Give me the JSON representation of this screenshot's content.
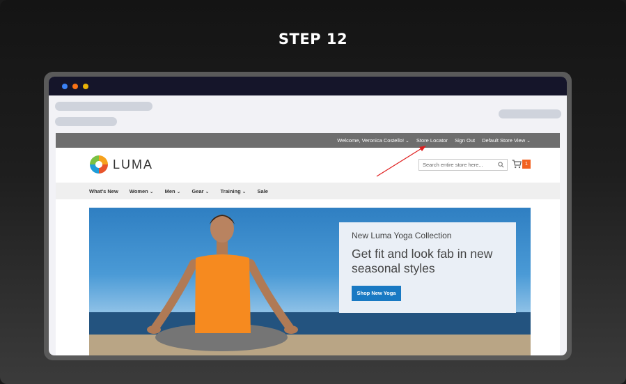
{
  "step": {
    "title": "STEP 12"
  },
  "topbar": {
    "welcome": "Welcome, Veronica Costello!",
    "store_locator": "Store Locator",
    "sign_out": "Sign Out",
    "store_view": "Default Store View"
  },
  "header": {
    "logo_text": "LUMA",
    "search_placeholder": "Search entire store here...",
    "cart_count": "1"
  },
  "nav": {
    "items": [
      "What's New",
      "Women",
      "Men",
      "Gear",
      "Training",
      "Sale"
    ]
  },
  "hero": {
    "subtitle": "New Luma Yoga Collection",
    "title": "Get fit and look fab in new seasonal styles",
    "button": "Shop New Yoga"
  },
  "colors": {
    "accent_button": "#1979c3",
    "cart_badge": "#f26322",
    "annotation_arrow": "#e02020"
  }
}
